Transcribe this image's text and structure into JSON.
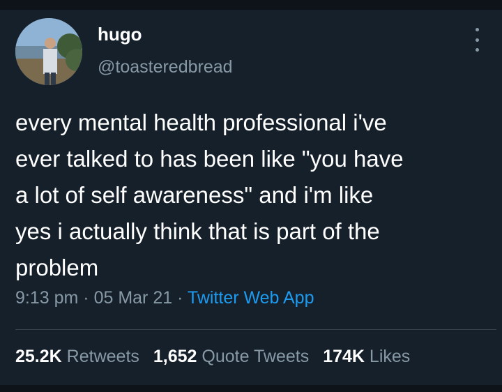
{
  "user": {
    "name": "hugo",
    "handle": "@toasteredbread"
  },
  "tweet": {
    "lines": [
      "every mental health professional i've",
      "ever talked to has been like \"you have",
      "a lot of self awareness\" and i'm like",
      "yes i actually think that is part of the",
      "problem"
    ]
  },
  "meta": {
    "time": "9:13 pm",
    "sep": "·",
    "date": "05 Mar 21",
    "app": "Twitter Web App"
  },
  "stats": {
    "retweets_count": "25.2K",
    "retweets_label": "Retweets",
    "quotes_count": "1,652",
    "quotes_label": "Quote Tweets",
    "likes_count": "174K",
    "likes_label": "Likes"
  },
  "icons": {
    "more": "more-options-icon"
  },
  "colors": {
    "background": "#15202b",
    "secondary_text": "#8899a6",
    "link": "#1d9bf0"
  }
}
